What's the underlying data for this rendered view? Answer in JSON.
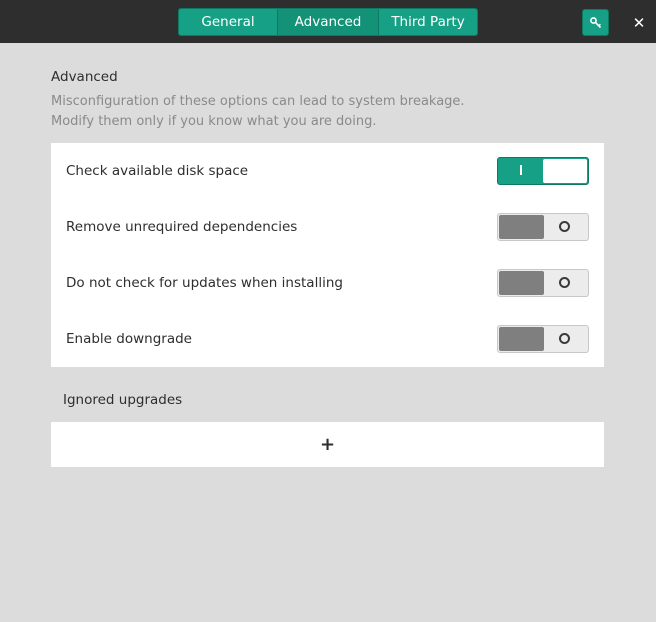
{
  "tabs": [
    {
      "label": "General"
    },
    {
      "label": "Advanced"
    },
    {
      "label": "Third Party"
    }
  ],
  "titlebar": {
    "key_icon": "key-icon",
    "close_icon": "close-icon",
    "close_glyph": "✕"
  },
  "advanced": {
    "title": "Advanced",
    "hint_line1": "Misconfiguration of these options can lead to system breakage.",
    "hint_line2": "Modify them only if you know what you are doing.",
    "options": [
      {
        "label": "Check available disk space",
        "enabled": true
      },
      {
        "label": "Remove unrequired dependencies",
        "enabled": false
      },
      {
        "label": "Do not check for updates when installing",
        "enabled": false
      },
      {
        "label": "Enable downgrade",
        "enabled": false
      }
    ]
  },
  "ignored": {
    "title": "Ignored upgrades",
    "add_glyph": "+"
  },
  "colors": {
    "accent": "#16a085",
    "titlebar": "#2e2e2e",
    "background": "#dcdcdc"
  }
}
